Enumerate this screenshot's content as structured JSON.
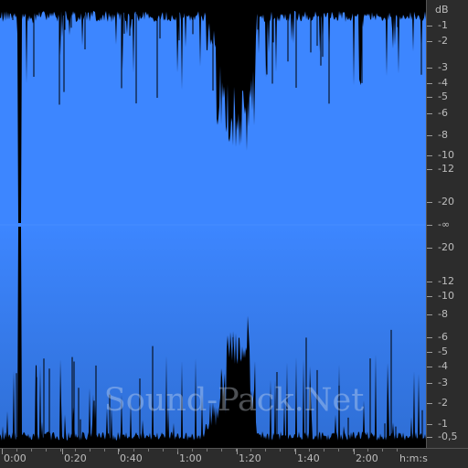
{
  "waveform": {
    "fill_color": "#3d86ff",
    "fill_color_dark": "#2f6fd6",
    "background": "#000000",
    "center_marker": "-∞"
  },
  "db_scale": {
    "unit": "dB",
    "labels": [
      "-1",
      "-2",
      "-3",
      "-4",
      "-5",
      "-6",
      "-8",
      "-10",
      "-12",
      "-20",
      "-∞",
      "-20",
      "-12",
      "-10",
      "-8",
      "-6",
      "-5",
      "-4",
      "-3",
      "-2",
      "-1",
      "-0,5"
    ]
  },
  "time_ruler": {
    "labels": [
      "0:00",
      "0:20",
      "0:40",
      "1:00",
      "1:20",
      "1:40",
      "2:00"
    ],
    "unit": "h:m:s"
  },
  "watermark": "Sound-Pack.Net"
}
